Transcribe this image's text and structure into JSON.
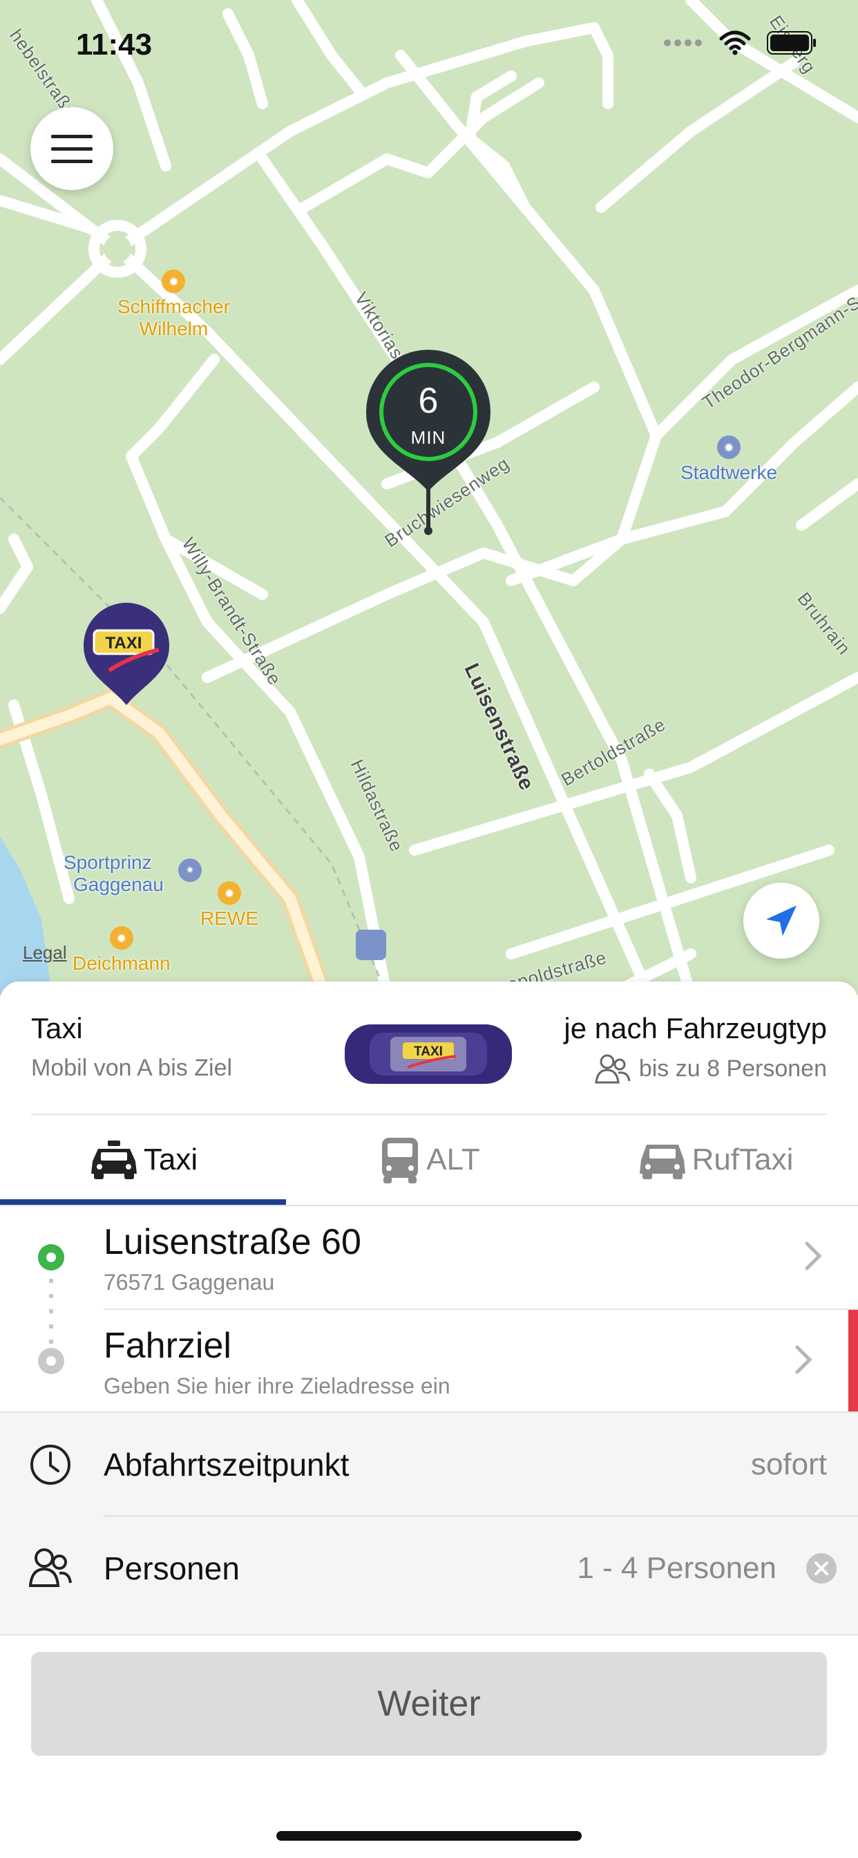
{
  "status_bar": {
    "time": "11:43"
  },
  "map": {
    "streets": {
      "top_left": "hebelstraße",
      "top_right": "Eisberg",
      "viktoriastrasse": "Viktoriastr",
      "theodor": "Theodor-Bergmann-S",
      "bruchwiesenweg": "Bruchwiesenweg",
      "willy_brandt": "Willy-Brandt-Straße",
      "luisenstrasse": "Luisenstraße",
      "bruhrain": "Bruhrain",
      "bertoldstrasse": "Bertoldstraße",
      "hildastrasse": "Hildastraße",
      "leopoldstrasse": "opoldstraße"
    },
    "pois": {
      "schiffmacher_line1": "Schiffmacher",
      "schiffmacher_line2": "Wilhelm",
      "stadtwerke": "Stadtwerke",
      "sportprinz_line1": "Sportprinz",
      "sportprinz_line2": "Gaggenau",
      "rewe": "REWE",
      "deichmann": "Deichmann"
    },
    "eta": {
      "value": "6",
      "unit": "MIN"
    },
    "taxi_logo_text": "TAXI",
    "legal": "Legal"
  },
  "service": {
    "title": "Taxi",
    "subtitle": "Mobil von A bis Ziel",
    "vehicle_type": "je nach Fahrzeugtyp",
    "capacity": "bis zu 8 Personen"
  },
  "tabs": [
    {
      "label": "Taxi",
      "icon": "taxi-car-icon",
      "active": true
    },
    {
      "label": "ALT",
      "icon": "van-icon",
      "active": false
    },
    {
      "label": "RufTaxi",
      "icon": "car-icon",
      "active": false
    }
  ],
  "origin": {
    "title": "Luisenstraße 60",
    "subtitle": "76571 Gaggenau"
  },
  "destination": {
    "title": "Fahrziel",
    "subtitle": "Geben Sie hier ihre Zieladresse ein"
  },
  "options": {
    "departure": {
      "label": "Abfahrtszeitpunkt",
      "value": "sofort",
      "icon": "clock-icon"
    },
    "persons": {
      "label": "Personen",
      "value": "1 - 4 Personen",
      "icon": "persons-icon"
    }
  },
  "continue_label": "Weiter",
  "colors": {
    "accent": "#1e3d8f",
    "map_green": "#cfe5c0",
    "eta_ring": "#2ecc40",
    "origin_dot": "#3cb54a",
    "alert_red": "#e53a4a",
    "taxi_pin": "#3a2f7a"
  }
}
